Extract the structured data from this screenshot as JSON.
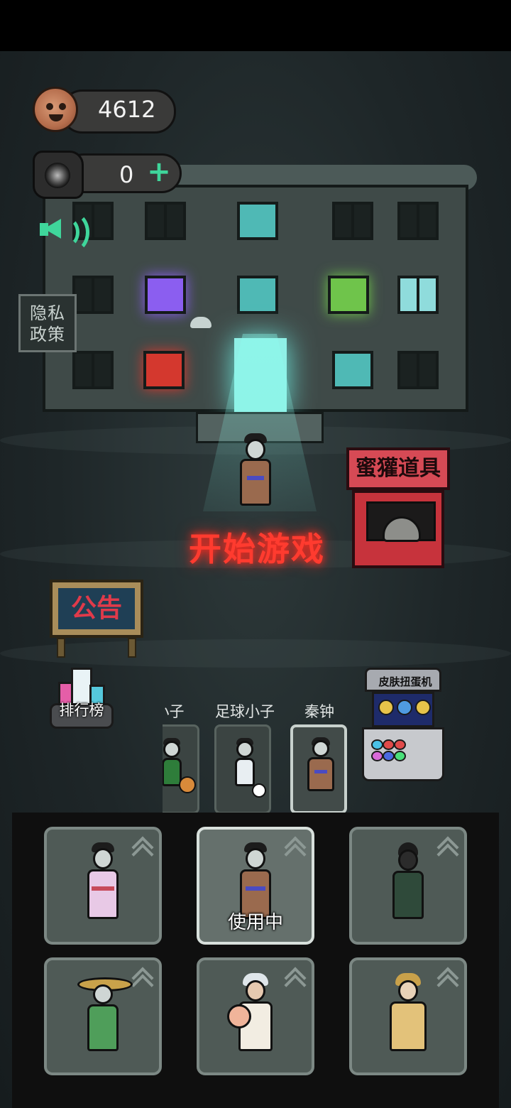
{
  "hud": {
    "coins": "4612",
    "puzzle_pieces": "0",
    "add_symbol": "+",
    "sound_state": "on"
  },
  "side_buttons": {
    "privacy": "隐私\n政策",
    "notice": "公告",
    "leaderboard": "排行榜"
  },
  "start_game": "开始游戏",
  "shop_sign": "蜜獾道具",
  "gacha_title": "皮肤扭蛋机",
  "characters": [
    {
      "name": "球小子",
      "accent": "#2e7d3a",
      "prop": "basketball"
    },
    {
      "name": "足球小子",
      "accent": "#e8eef2",
      "prop": "soccer-ball"
    },
    {
      "name": "秦钟",
      "accent": "#9a6a4e",
      "prop": "none"
    }
  ],
  "selected_character": "秦钟",
  "skins": [
    {
      "id": "skin-1",
      "status": ""
    },
    {
      "id": "skin-2",
      "status": "使用中"
    },
    {
      "id": "skin-3",
      "status": ""
    },
    {
      "id": "skin-4",
      "status": ""
    },
    {
      "id": "skin-5",
      "status": ""
    },
    {
      "id": "skin-6",
      "status": ""
    }
  ],
  "colors": {
    "neon_red": "#ff3b2f",
    "accent_green": "#3fd69b",
    "shop_red": "#c7333c"
  }
}
